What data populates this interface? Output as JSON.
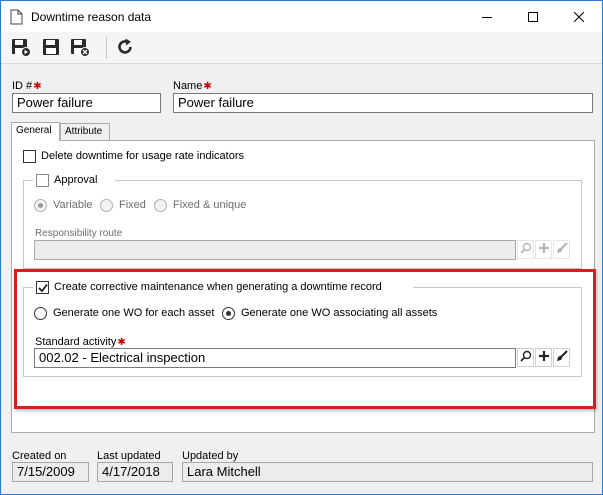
{
  "window": {
    "title": "Downtime reason data",
    "minimize_icon": "minimize-icon",
    "maximize_icon": "maximize-icon",
    "close_icon": "close-icon"
  },
  "toolbar": {
    "buttons": [
      {
        "name": "save-new-icon"
      },
      {
        "name": "save-icon"
      },
      {
        "name": "save-close-icon"
      },
      {
        "name": "refresh-icon"
      }
    ]
  },
  "header": {
    "id_label": "ID #",
    "id_value": "Power failure",
    "name_label": "Name",
    "name_value": "Power failure"
  },
  "tabs": [
    {
      "label": "General",
      "active": true
    },
    {
      "label": "Attribute",
      "active": false
    }
  ],
  "general": {
    "delete_downtime_label": "Delete downtime for usage rate indicators",
    "approval": {
      "label": "Approval",
      "options": [
        "Variable",
        "Fixed",
        "Fixed & unique"
      ],
      "selected": "Variable",
      "responsibility_route_label": "Responsibility route",
      "responsibility_route_value": ""
    },
    "corrective": {
      "label": "Create corrective maintenance when generating a downtime record",
      "checked": true,
      "options": [
        "Generate one WO for each asset",
        "Generate one WO associating all assets"
      ],
      "selected": "Generate one WO associating all assets",
      "standard_activity_label": "Standard activity",
      "standard_activity_value": "002.02 - Electrical inspection"
    }
  },
  "footer": {
    "created_on_label": "Created on",
    "created_on_value": "7/15/2009",
    "last_updated_label": "Last updated",
    "last_updated_value": "4/17/2018",
    "updated_by_label": "Updated by",
    "updated_by_value": "Lara Mitchell"
  },
  "colors": {
    "highlight_border": "#d62020",
    "window_border": "#2b79d6",
    "required_marker": "#cc0000"
  }
}
